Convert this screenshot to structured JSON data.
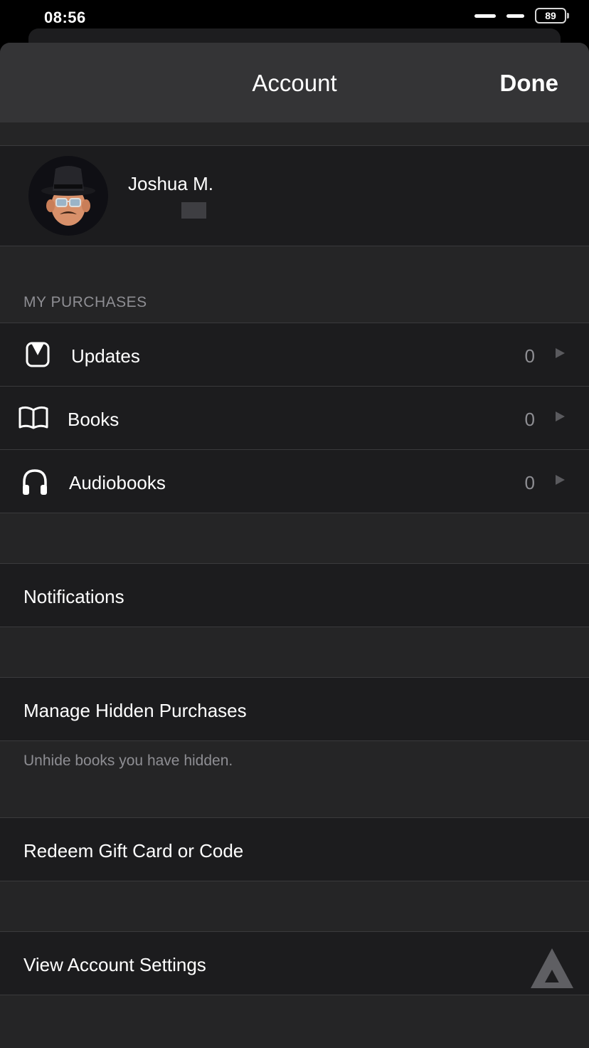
{
  "status_bar": {
    "time": "08:56",
    "battery": "89"
  },
  "nav": {
    "title": "Account",
    "done_label": "Done"
  },
  "profile": {
    "name": "Joshua M."
  },
  "purchases": {
    "header": "MY PURCHASES",
    "items": [
      {
        "label": "Updates",
        "count": "0",
        "icon": "updates-icon"
      },
      {
        "label": "Books",
        "count": "0",
        "icon": "book-icon"
      },
      {
        "label": "Audiobooks",
        "count": "0",
        "icon": "headphones-icon"
      }
    ]
  },
  "notifications": {
    "label": "Notifications"
  },
  "hidden": {
    "label": "Manage Hidden Purchases",
    "note": "Unhide books you have hidden."
  },
  "redeem": {
    "label": "Redeem Gift Card or Code"
  },
  "settings": {
    "label": "View Account Settings"
  }
}
